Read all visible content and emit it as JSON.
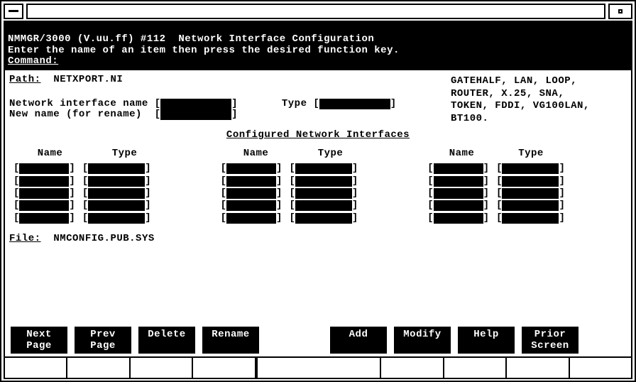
{
  "header": {
    "line1": "NMMGR/3000 (V.uu.ff) #112  Network Interface Configuration",
    "line2": "Enter the name of an item then press the desired function key.",
    "cmd_label": "Command:"
  },
  "path_label": "Path:",
  "path_value": "NETXPORT.NI",
  "form": {
    "ni_label": "Network interface name",
    "type_label": "Type",
    "rename_label": "New name (for rename)"
  },
  "type_help": "GATEHALF, LAN, LOOP,\nROUTER, X.25, SNA,\nTOKEN, FDDI, VG100LAN,\nBT100.",
  "section_title": "Configured Network Interfaces",
  "columns": {
    "name": "Name",
    "type": "Type"
  },
  "file_label": "File:",
  "file_value": "NMCONFIG.PUB.SYS",
  "fkeys": {
    "f1": "Next\nPage",
    "f2": "Prev\nPage",
    "f3": "Delete",
    "f4": "Rename",
    "f5": "Add",
    "f6": "Modify",
    "f7": "Help",
    "f8": "Prior\nScreen"
  }
}
